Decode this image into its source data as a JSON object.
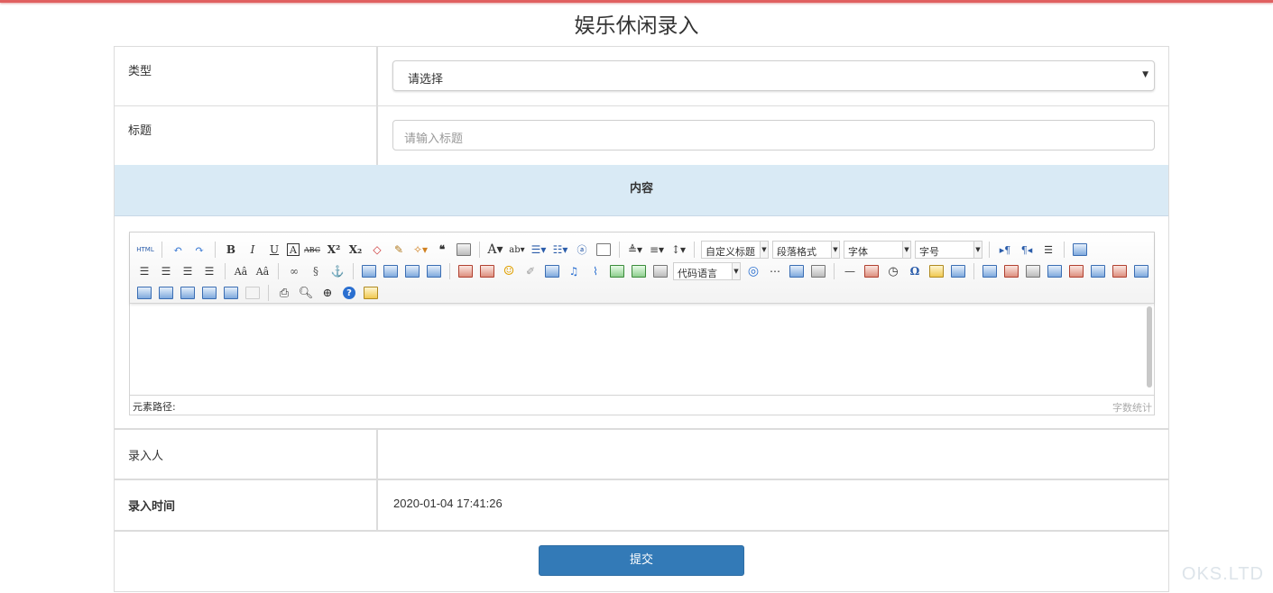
{
  "page": {
    "title": "娱乐休闲录入"
  },
  "form": {
    "type_label": "类型",
    "type_value": "请选择",
    "title_label": "标题",
    "title_placeholder": "请输入标题",
    "content_label": "内容",
    "recorder_label": "录入人",
    "recorder_value": "",
    "time_label": "录入时间",
    "time_value": "2020-01-04 17:41:26",
    "submit_label": "提交"
  },
  "editor": {
    "html_label": "HTML",
    "combo_custom_title": "自定义标题",
    "combo_paragraph": "段落格式",
    "combo_font": "字体",
    "combo_size": "字号",
    "combo_code": "代码语言",
    "path_label": "元素路径:",
    "wordcount_label": "字数统计"
  },
  "watermark": "OKS.LTD"
}
